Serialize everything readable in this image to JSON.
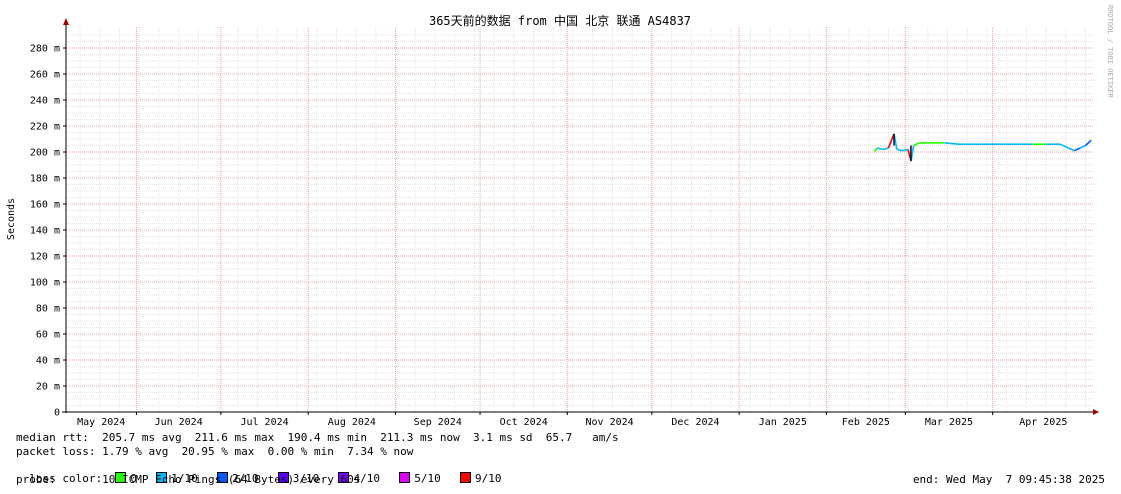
{
  "chart_data": {
    "type": "line",
    "title": "365天前的数据 from 中国 北京 联通 AS4837",
    "ylabel": "Seconds",
    "xlabel": "",
    "ylim": [
      0,
      290
    ],
    "y_ticks": [
      {
        "value": 0,
        "label": "0"
      },
      {
        "value": 20,
        "label": "20 m"
      },
      {
        "value": 40,
        "label": "40 m"
      },
      {
        "value": 60,
        "label": "60 m"
      },
      {
        "value": 80,
        "label": "80 m"
      },
      {
        "value": 100,
        "label": "100 m"
      },
      {
        "value": 120,
        "label": "120 m"
      },
      {
        "value": 140,
        "label": "140 m"
      },
      {
        "value": 160,
        "label": "160 m"
      },
      {
        "value": 180,
        "label": "180 m"
      },
      {
        "value": 200,
        "label": "200 m"
      },
      {
        "value": 220,
        "label": "220 m"
      },
      {
        "value": 240,
        "label": "240 m"
      },
      {
        "value": 260,
        "label": "260 m"
      },
      {
        "value": 280,
        "label": "280 m"
      }
    ],
    "xlim": [
      "2024-05-07",
      "2025-05-07"
    ],
    "x_ticks": [
      {
        "date": "2024-05-01",
        "label": "May 2024"
      },
      {
        "date": "2024-06-01",
        "label": "Jun 2024"
      },
      {
        "date": "2024-07-01",
        "label": "Jul 2024"
      },
      {
        "date": "2024-08-01",
        "label": "Aug 2024"
      },
      {
        "date": "2024-09-01",
        "label": "Sep 2024"
      },
      {
        "date": "2024-10-01",
        "label": "Oct 2024"
      },
      {
        "date": "2024-11-01",
        "label": "Nov 2024"
      },
      {
        "date": "2024-12-01",
        "label": "Dec 2024"
      },
      {
        "date": "2025-01-01",
        "label": "Jan 2025"
      },
      {
        "date": "2025-02-01",
        "label": "Feb 2025"
      },
      {
        "date": "2025-03-01",
        "label": "Mar 2025"
      },
      {
        "date": "2025-04-01",
        "label": "Apr 2025"
      }
    ],
    "grid": true,
    "series": [
      {
        "values": [
          {
            "date": "2025-02-18",
            "ms": 200,
            "loss": "1/10"
          },
          {
            "date": "2025-02-19",
            "ms": 203,
            "loss": "0"
          },
          {
            "date": "2025-02-21",
            "ms": 202,
            "loss": "1/10"
          },
          {
            "date": "2025-02-23",
            "ms": 203,
            "loss": "1/10"
          },
          {
            "date": "2025-02-25",
            "ms": 214,
            "loss": "9/10"
          },
          {
            "date": "2025-02-26",
            "ms": 202,
            "loss": "1/10"
          },
          {
            "date": "2025-02-28",
            "ms": 201,
            "loss": "1/10"
          },
          {
            "date": "2025-03-02",
            "ms": 202,
            "loss": "1/10"
          },
          {
            "date": "2025-03-03",
            "ms": 193,
            "loss": "9/10"
          },
          {
            "date": "2025-03-04",
            "ms": 205,
            "loss": "1/10"
          },
          {
            "date": "2025-03-06",
            "ms": 207,
            "loss": "0"
          },
          {
            "date": "2025-03-10",
            "ms": 207,
            "loss": "0"
          },
          {
            "date": "2025-03-15",
            "ms": 207,
            "loss": "0"
          },
          {
            "date": "2025-03-20",
            "ms": 206,
            "loss": "1/10"
          },
          {
            "date": "2025-03-25",
            "ms": 206,
            "loss": "1/10"
          },
          {
            "date": "2025-03-30",
            "ms": 206,
            "loss": "1/10"
          },
          {
            "date": "2025-04-05",
            "ms": 206,
            "loss": "1/10"
          },
          {
            "date": "2025-04-10",
            "ms": 206,
            "loss": "1/10"
          },
          {
            "date": "2025-04-15",
            "ms": 206,
            "loss": "1/10"
          },
          {
            "date": "2025-04-20",
            "ms": 206,
            "loss": "0"
          },
          {
            "date": "2025-04-25",
            "ms": 206,
            "loss": "1/10"
          },
          {
            "date": "2025-04-28",
            "ms": 203,
            "loss": "1/10"
          },
          {
            "date": "2025-04-30",
            "ms": 201,
            "loss": "1/10"
          },
          {
            "date": "2025-05-02",
            "ms": 203,
            "loss": "2/10"
          },
          {
            "date": "2025-05-04",
            "ms": 205,
            "loss": "1/10"
          },
          {
            "date": "2025-05-06",
            "ms": 209,
            "loss": "2/10"
          }
        ]
      }
    ]
  },
  "watermark": "RRDTOOL / TOBI OETIKER",
  "stats": {
    "median_rtt": "median rtt:  205.7 ms avg  211.6 ms max  190.4 ms min  211.3 ms now  3.1 ms sd  65.7   am/s",
    "packet_loss": "packet loss: 1.79 % avg  20.95 % max  0.00 % min  7.34 % now",
    "loss_color_label": "loss color:",
    "loss_colors": [
      {
        "label": "0",
        "color": "#26ff00"
      },
      {
        "label": "1/10",
        "color": "#00b8ff"
      },
      {
        "label": "2/10",
        "color": "#0059ff"
      },
      {
        "label": "3/10",
        "color": "#5e00ff"
      },
      {
        "label": "4/10",
        "color": "#7e00ff"
      },
      {
        "label": "5/10",
        "color": "#dd00ff"
      },
      {
        "label": "9/10",
        "color": "#ff0000"
      }
    ],
    "probe": "probe:       10 ICMP Echo Pings (64 Bytes) every 60s",
    "end": "end: Wed May  7 09:45:38 2025"
  }
}
